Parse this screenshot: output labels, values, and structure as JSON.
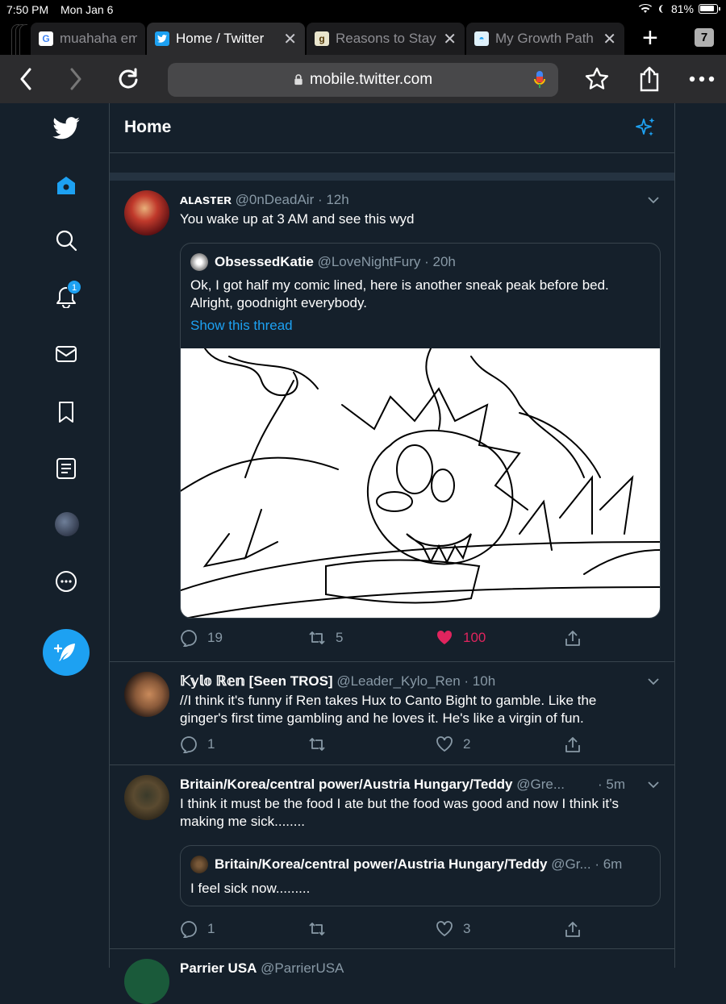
{
  "status": {
    "time": "7:50 PM",
    "date": "Mon Jan 6",
    "battery": "81%"
  },
  "tabs": [
    {
      "label": "muahaha emo",
      "favicon": "google-icon",
      "active": false
    },
    {
      "label": "Home / Twitter",
      "favicon": "twitter-icon",
      "active": true
    },
    {
      "label": "Reasons to Stay",
      "favicon": "goodreads-icon",
      "active": false
    },
    {
      "label": "My Growth Path",
      "favicon": "growth-icon",
      "active": false
    }
  ],
  "tab_count": "7",
  "url": "mobile.twitter.com",
  "nav": {
    "notifications_badge": "1"
  },
  "header": {
    "title": "Home"
  },
  "tweets": [
    {
      "name": "ᴀʟᴀsᴛᴇʀ",
      "handle": "@0nDeadAir",
      "time": "· 12h",
      "text": "You wake up at 3 AM and see this wyd",
      "quote": {
        "name": "ObsessedKatie",
        "handle": "@LoveNightFury",
        "time": "· 20h",
        "text": "Ok, I got half my comic lined, here is another sneak peak before bed. Alright, goodnight everybody.",
        "link": "Show this thread"
      },
      "replies": "19",
      "retweets": "5",
      "likes": "100",
      "liked": true
    },
    {
      "name": "𝕂𝕪𝕝𝕠 ℝ𝕖𝕟 [Seen TROS]",
      "handle": "@Leader_Kylo_Ren",
      "time": "· 10h",
      "text": "//I think it's funny if Ren takes Hux to Canto Bight to gamble. Like the ginger's first time gambling and he loves it. He's like a virgin of fun.",
      "replies": "1",
      "retweets": "",
      "likes": "2"
    },
    {
      "name": "Britain/Korea/central power/Austria Hungary/Teddy",
      "handle": "@Gre...",
      "time": "· 5m",
      "text": "I think it must be the food I ate but the food was good and now I think it’s making me sick........",
      "quote": {
        "name": "Britain/Korea/central power/Austria Hungary/Teddy",
        "handle": "@Gr...",
        "time": "· 6m",
        "text": "I feel sick now........."
      },
      "replies": "1",
      "retweets": "",
      "likes": "3"
    },
    {
      "name": "Parrier USA",
      "handle": "@ParrierUSA"
    }
  ],
  "colors": {
    "accent": "#1da1f2",
    "like": "#e0245e",
    "bg": "#15202b",
    "border": "#38444d",
    "muted": "#8899a6"
  }
}
